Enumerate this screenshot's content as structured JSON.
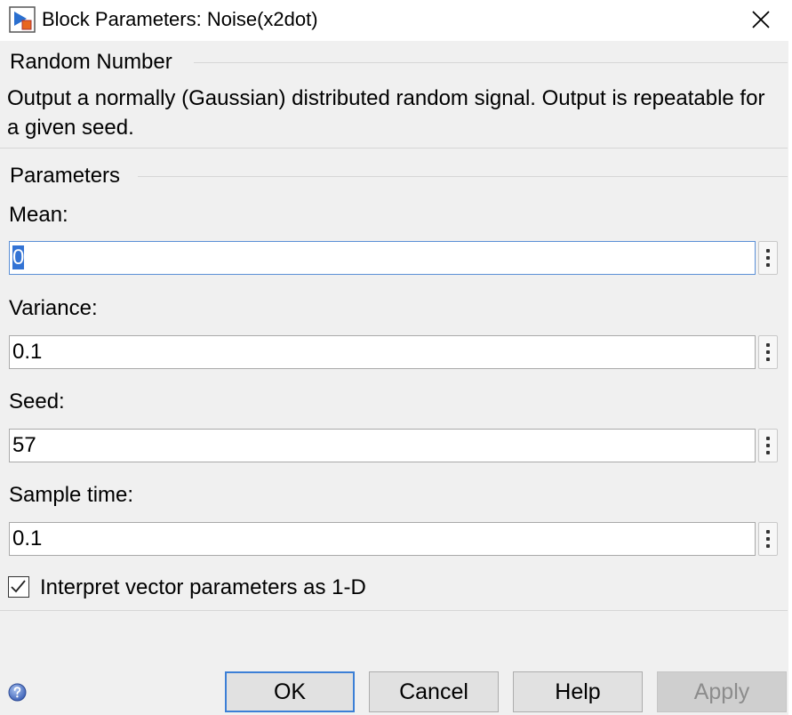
{
  "window": {
    "title": "Block Parameters: Noise(x2dot)",
    "close_icon": "close-icon",
    "app_icon": "simulink-block-icon"
  },
  "block": {
    "type_title": "Random Number",
    "description": "Output a normally (Gaussian) distributed random signal.  Output is repeatable for a given seed."
  },
  "parameters": {
    "section_title": "Parameters",
    "fields": [
      {
        "label": "Mean:",
        "value": "0"
      },
      {
        "label": "Variance:",
        "value": "0.1"
      },
      {
        "label": "Seed:",
        "value": "57"
      },
      {
        "label": "Sample time:",
        "value": "0.1"
      }
    ],
    "checkbox": {
      "label": "Interpret vector parameters as 1-D",
      "checked": true
    }
  },
  "buttons": {
    "ok": "OK",
    "cancel": "Cancel",
    "help": "Help",
    "apply": "Apply"
  },
  "colors": {
    "accent": "#3c7fd6",
    "selection": "#3373d4",
    "background": "#f0f0f0"
  }
}
